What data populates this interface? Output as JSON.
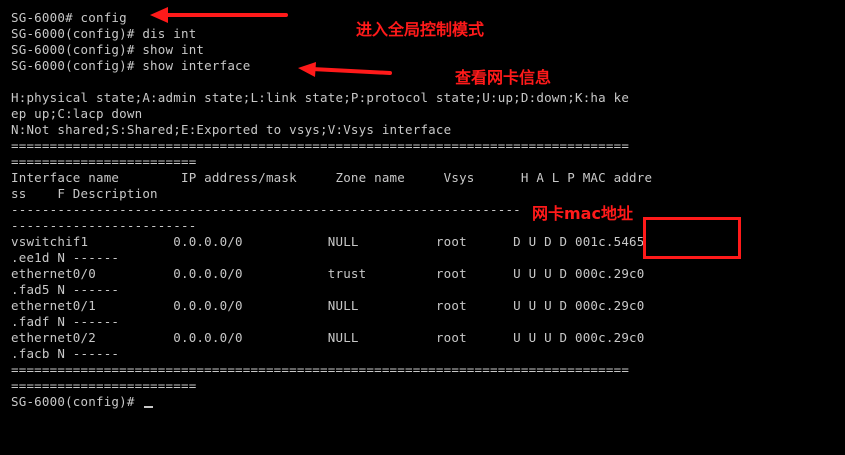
{
  "terminal": {
    "lines": [
      "SG-6000# config",
      "SG-6000(config)# dis int",
      "SG-6000(config)# show int",
      "SG-6000(config)# show interface",
      "",
      "H:physical state;A:admin state;L:link state;P:protocol state;U:up;D:down;K:ha ke",
      "ep up;C:lacp down",
      "N:Not shared;S:Shared;E:Exported to vsys;V:Vsys interface",
      "================================================================================",
      "========================",
      "Interface name        IP address/mask     Zone name     Vsys      H A L P MAC addre",
      "ss    F Description",
      "------------------------------------------------------------------",
      "------------------------",
      "vswitchif1           0.0.0.0/0           NULL          root      D U D D 001c.5465",
      ".ee1d N ------",
      "ethernet0/0          0.0.0.0/0           trust         root      U U U D 000c.29c0",
      ".fad5 N ------",
      "ethernet0/1          0.0.0.0/0           NULL          root      U U U D 000c.29c0",
      ".fadf N ------",
      "ethernet0/2          0.0.0.0/0           NULL          root      U U U D 000c.29c0",
      ".facb N ------",
      "================================================================================",
      "========================",
      "SG-6000(config)# "
    ]
  },
  "annotations": {
    "global_config_label": "进入全局控制模式",
    "view_nic_label": "查看网卡信息",
    "nic_mac_label": "网卡mac地址",
    "color": "#ff1a1a"
  }
}
